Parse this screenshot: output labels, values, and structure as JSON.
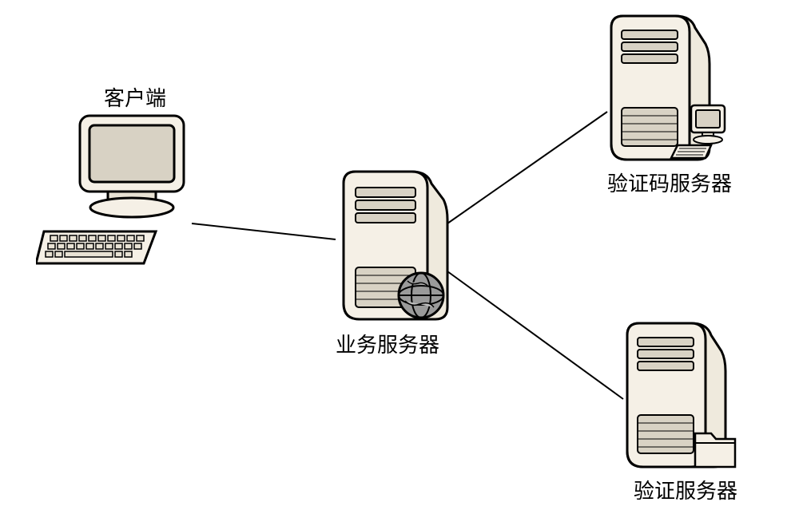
{
  "nodes": {
    "client": {
      "label": "客户端"
    },
    "business_server": {
      "label": "业务服务器"
    },
    "captcha_server": {
      "label": "验证码服务器"
    },
    "verify_server": {
      "label": "验证服务器"
    }
  },
  "connections": [
    {
      "from": "client",
      "to": "business_server"
    },
    {
      "from": "business_server",
      "to": "captcha_server"
    },
    {
      "from": "business_server",
      "to": "verify_server"
    }
  ]
}
